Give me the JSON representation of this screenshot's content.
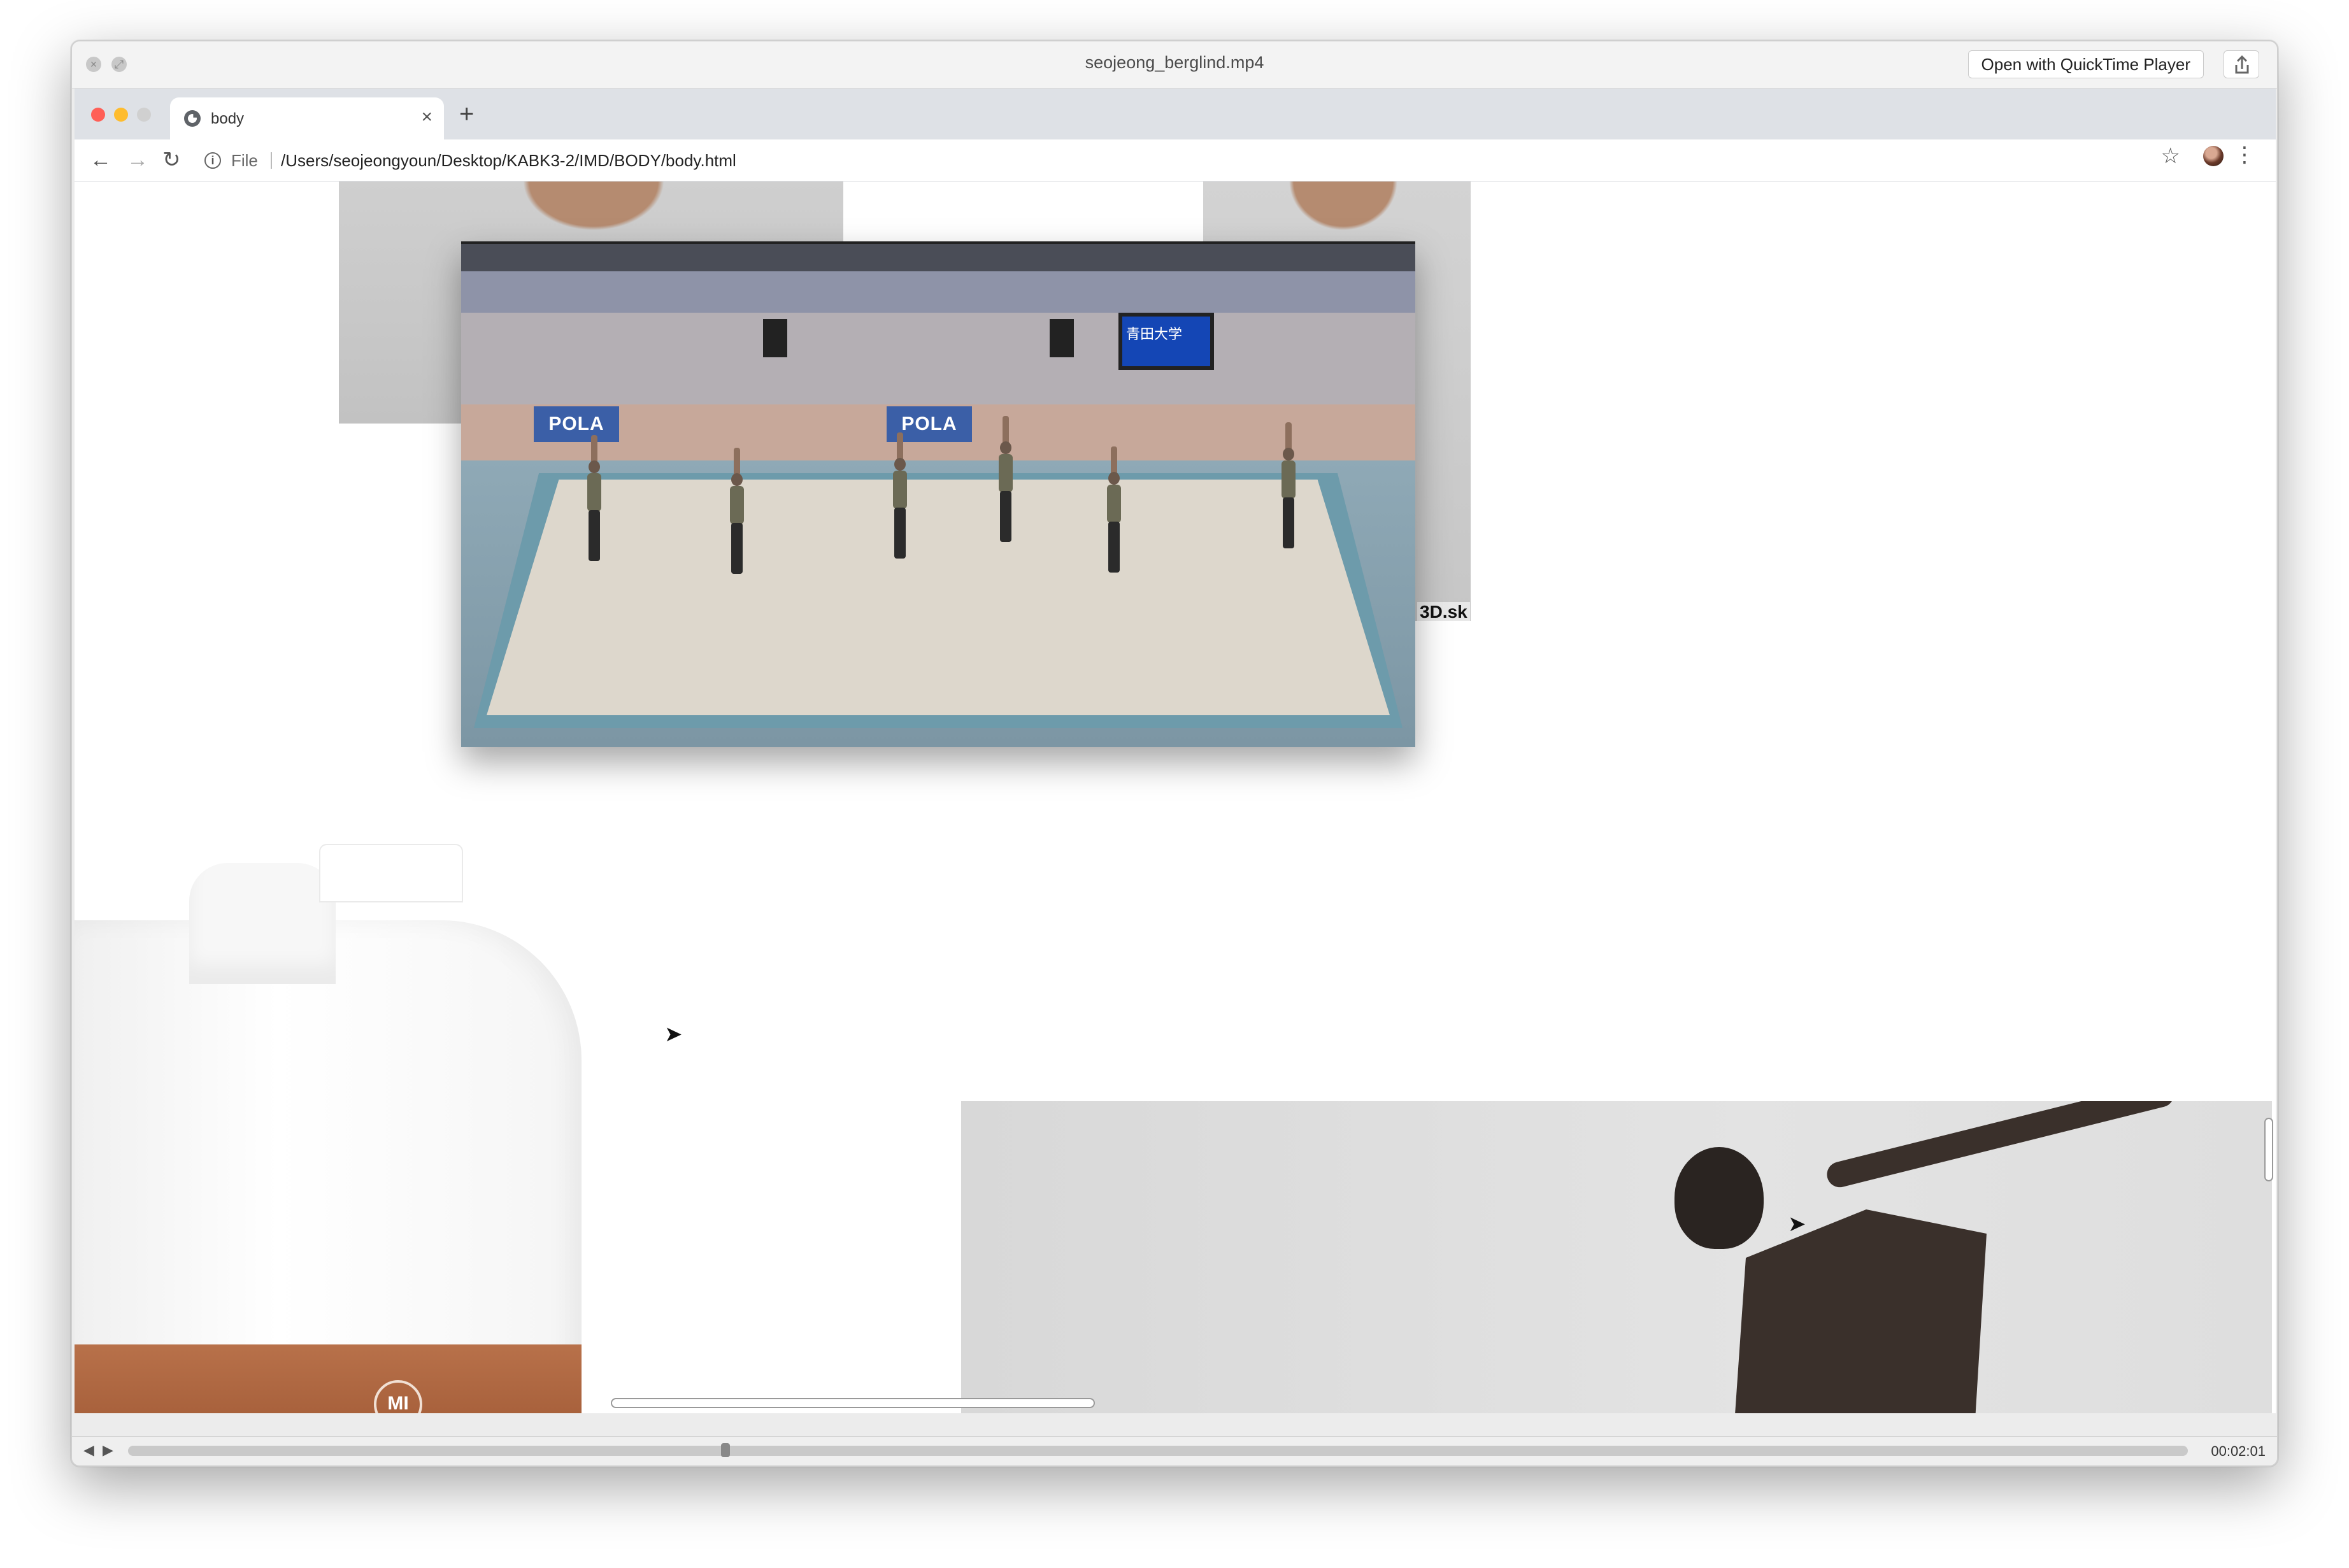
{
  "quicktime": {
    "filename": "seojeong_berglind.mp4",
    "open_button": "Open with QuickTime Player",
    "timecode": "00:02:01",
    "progress_fraction": 0.29
  },
  "browser": {
    "tab_title": "body",
    "new_tab": "+",
    "close_tab": "×",
    "file_label": "File",
    "url": "/Users/seojeongyoun/Desktop/KABK3-2/IMD/BODY/body.html"
  },
  "page": {
    "video_signs": [
      "POLA",
      "POLA"
    ],
    "watermark": "3D.sk",
    "screen_text": "青田大学",
    "bottle_logo": "MI"
  },
  "colors": {
    "close": "#ff5f57",
    "minimize": "#febc2e",
    "maximize": "#d0d0d0"
  },
  "icons": {
    "back": "arrow-left-icon",
    "forward": "arrow-right-icon",
    "reload": "reload-icon",
    "info": "info-icon",
    "star": "star-icon",
    "menu": "kebab-menu-icon",
    "share": "share-icon"
  }
}
